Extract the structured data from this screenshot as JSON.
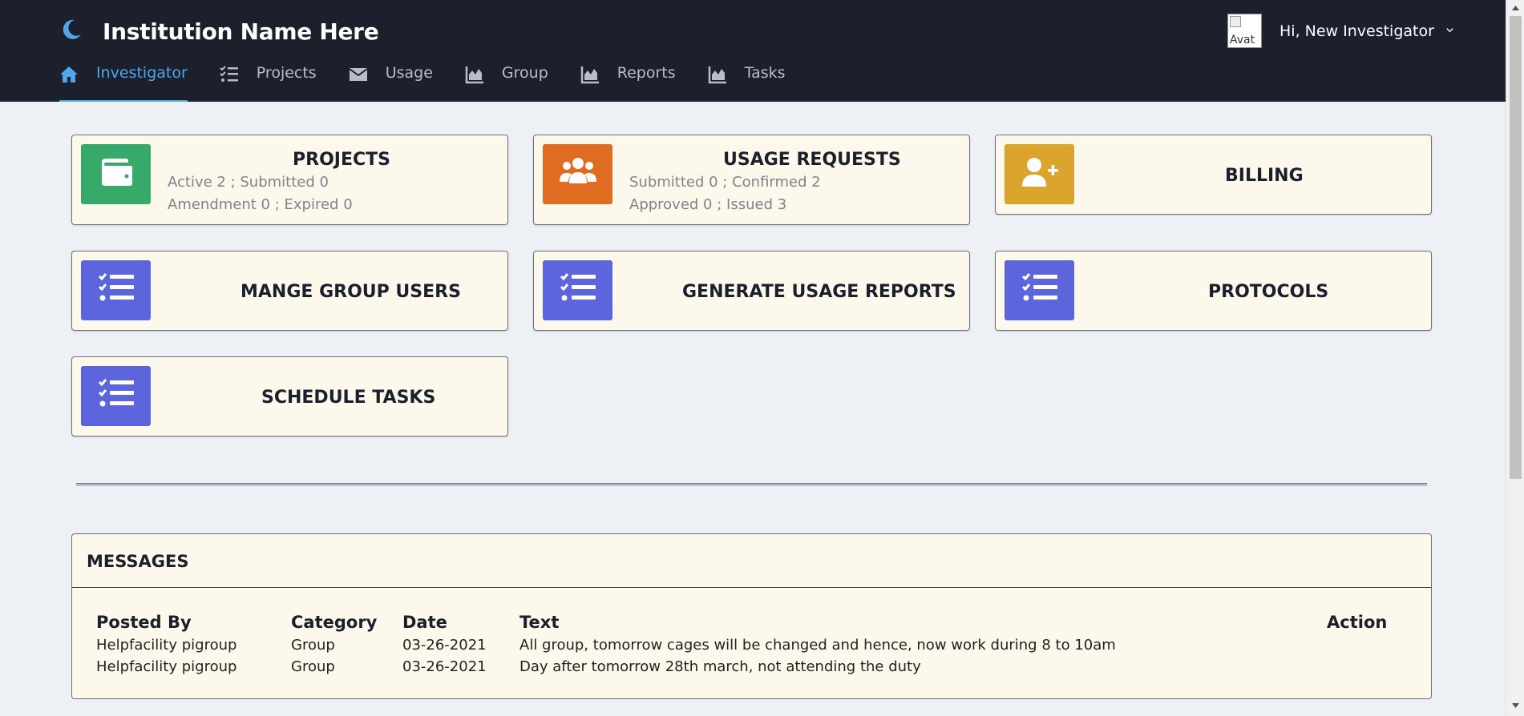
{
  "header": {
    "title": "Institution Name Here",
    "avatar_alt": "Avat",
    "greeting": "Hi, New Investigator",
    "logo_icon": "moon-icon",
    "colors": {
      "background": "#1b202c",
      "accent": "#4fa6e8"
    }
  },
  "nav": {
    "items": [
      {
        "label": "Investigator",
        "icon": "home-icon",
        "active": true
      },
      {
        "label": "Projects",
        "icon": "checklist-icon",
        "active": false
      },
      {
        "label": "Usage",
        "icon": "envelope-icon",
        "active": false
      },
      {
        "label": "Group",
        "icon": "area-chart-icon",
        "active": false
      },
      {
        "label": "Reports",
        "icon": "area-chart-icon",
        "active": false
      },
      {
        "label": "Tasks",
        "icon": "area-chart-icon",
        "active": false
      }
    ]
  },
  "cards": {
    "projects": {
      "title": "PROJECTS",
      "line1": "Active 2 ; Submitted 0",
      "line2": "Amendment 0 ; Expired 0",
      "icon": "wallet-icon",
      "color": "#36a96b"
    },
    "usage_requests": {
      "title": "USAGE REQUESTS",
      "line1": "Submitted 0 ; Confirmed 2",
      "line2": "Approved 0 ; Issued 3",
      "icon": "users-icon",
      "color": "#e06c22"
    },
    "billing": {
      "title": "BILLING",
      "icon": "user-plus-icon",
      "color": "#dba42c"
    },
    "group_users": {
      "title": "MANGE GROUP USERS",
      "icon": "list-check-icon",
      "color": "#5c65db"
    },
    "usage_reports": {
      "title": "GENERATE USAGE REPORTS",
      "icon": "list-check-icon",
      "color": "#5c65db"
    },
    "protocols": {
      "title": "PROTOCOLS",
      "icon": "list-check-icon",
      "color": "#5c65db"
    },
    "schedule_tasks": {
      "title": "SCHEDULE TASKS",
      "icon": "list-check-icon",
      "color": "#5c65db"
    }
  },
  "messages": {
    "title": "MESSAGES",
    "columns": [
      "Posted By",
      "Category",
      "Date",
      "Text",
      "Action"
    ],
    "rows": [
      {
        "posted_by": "Helpfacility pigroup",
        "category": "Group",
        "date": "03-26-2021",
        "text": "All group, tomorrow cages will be changed and hence, now work during 8 to 10am",
        "action": ""
      },
      {
        "posted_by": "Helpfacility pigroup",
        "category": "Group",
        "date": "03-26-2021",
        "text": "Day after tomorrow 28th march, not attending the duty",
        "action": ""
      }
    ]
  }
}
